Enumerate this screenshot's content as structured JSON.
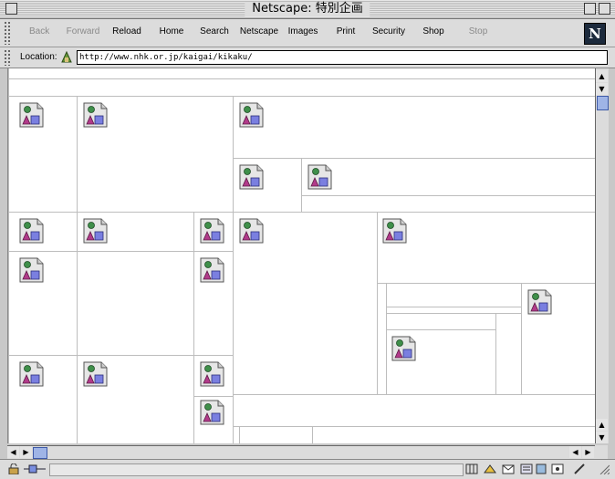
{
  "window": {
    "title": "Netscape: 特別企画"
  },
  "toolbar": {
    "back": "Back",
    "forward": "Forward",
    "reload": "Reload",
    "home": "Home",
    "search": "Search",
    "netscape": "Netscape",
    "images": "Images",
    "print": "Print",
    "security": "Security",
    "shop": "Shop",
    "stop": "Stop",
    "logo": "N"
  },
  "location": {
    "label": "Location:",
    "url": "http://www.nhk.or.jp/kaigai/kikaku/"
  },
  "colors": {
    "chrome": "#dcdcdc",
    "frame_line": "#bdbdbd",
    "scroll_thumb": "#9fb4e6"
  },
  "icons": [
    "broken-image-icon",
    "netscape-logo-icon",
    "lock-icon",
    "bookmark-icon"
  ]
}
